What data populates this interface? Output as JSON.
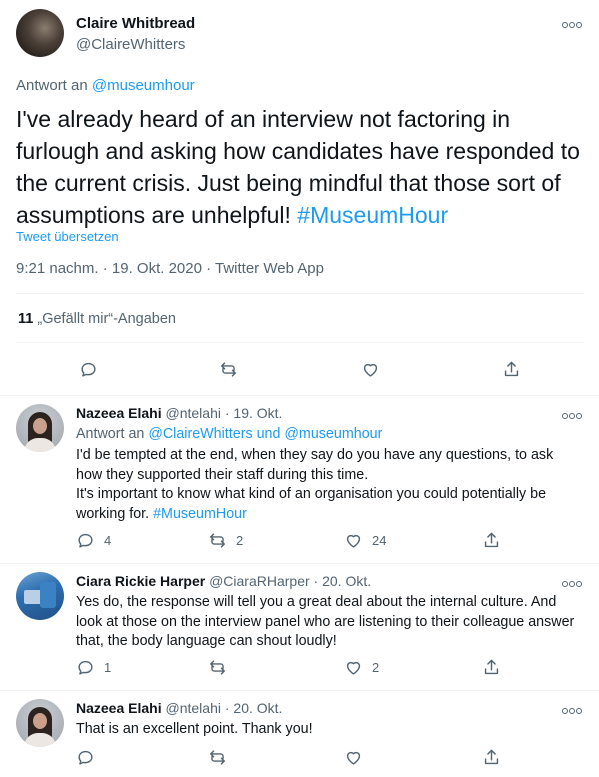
{
  "main_tweet": {
    "author_name": "Claire Whitbread",
    "author_handle": "@ClaireWhitters",
    "reply_to_prefix": "Antwort an",
    "reply_to_handle": "@museumhour",
    "text": "I've already heard of an interview not factoring in furlough and asking how candidates have responded to the current crisis. Just being mindful that those sort of assumptions are unhelpful!",
    "hashtag": "#MuseumHour",
    "translate_label": "Tweet übersetzen",
    "timestamp": "9:21 nachm. · 19. Okt. 2020 · Twitter Web App",
    "likes_count": "11",
    "likes_label": "„Gefällt mir“-Angaben"
  },
  "replies": [
    {
      "author_name": "Nazeea Elahi",
      "author_handle": "@ntelahi",
      "date": "· 19. Okt.",
      "reply_to_prefix": "Antwort an",
      "reply_to_handles": "@ClaireWhitters und @museumhour",
      "text": "I'd be tempted at the end, when they say do you have any questions, to ask how they supported their staff during this time.\nIt's important to know what kind of an organisation you could potentially be working for.",
      "hashtag": "#MuseumHour",
      "reply_count": "4",
      "retweet_count": "2",
      "like_count": "24"
    },
    {
      "author_name": "Ciara Rickie Harper",
      "author_handle": "@CiaraRHarper",
      "date": "· 20. Okt.",
      "text": "Yes do, the response will tell you a great deal about the internal culture. And look at those on the interview panel who are listening to their colleague answer that, the body language can shout loudly!",
      "reply_count": "1",
      "retweet_count": "",
      "like_count": "2"
    },
    {
      "author_name": "Nazeea Elahi",
      "author_handle": "@ntelahi",
      "date": "· 20. Okt.",
      "text": "That is an excellent point. Thank you!",
      "reply_count": "",
      "retweet_count": "",
      "like_count": ""
    }
  ],
  "colors": {
    "accent": "#1d9bf0",
    "secondary_text": "#536471",
    "primary_text": "#0f1419"
  }
}
